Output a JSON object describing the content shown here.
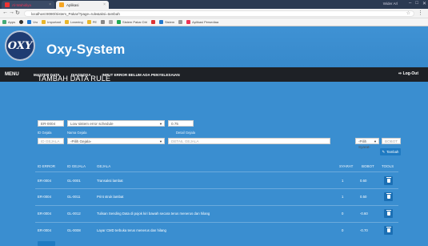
{
  "browser": {
    "tabs": [
      {
        "label": "Al-Wahidiya",
        "active": false
      },
      {
        "label": "Aplikasi",
        "active": true
      }
    ],
    "profile": "Wider Arl",
    "url": "localhost:8080/Sistem_Pakar/?page=rule&aksi=tambah",
    "bookmarks": [
      {
        "label": "Apps"
      },
      {
        "label": ""
      },
      {
        "label": "Vro"
      },
      {
        "label": "Important"
      },
      {
        "label": "Learning"
      },
      {
        "label": "PE"
      },
      {
        "label": ""
      },
      {
        "label": ""
      },
      {
        "label": "Sistem Pakar Diri"
      },
      {
        "label": ""
      },
      {
        "label": "Sistem"
      },
      {
        "label": ""
      },
      {
        "label": "Aplikasi Persediaa"
      }
    ]
  },
  "app": {
    "brand": "Oxy-System",
    "logo_text": "OXY",
    "menu_label": "MENU",
    "nav": [
      "MASTER DATA",
      "DIAGNOSA",
      "INPUT ERROR BELUM ADA PENYELESAIAN"
    ],
    "logout": "Log-Out",
    "page_title": "TAMBAH DATA RULE",
    "form": {
      "id_gejala_value": "ER-0004",
      "nama_gejala_value": "Low sistem error schedule",
      "detail_value": "0.75",
      "label_id": "ID Gejala",
      "label_nama": "Nama Gejala",
      "label_detail": "Detail Gejala",
      "id_gejala_ph": "ID GEJALA",
      "pilih_gejala": "-Pilih Gejala-",
      "detail_gejala_ph": "DETAIL GEJALA",
      "pilih_syarat": "-Pilih Syarat-",
      "bobot_ph": "BOBOT",
      "tambah": "Tambah"
    },
    "table": {
      "headers": [
        "ID ERROR",
        "ID GEJALA",
        "GEJALA",
        "SYARAT",
        "BOBOT",
        "TOOLS"
      ],
      "rows": [
        {
          "id_error": "ER-0004",
          "id_gejala": "GL-0001",
          "gejala": "Transaksi lambat",
          "syarat": "1",
          "bobot": "0.60"
        },
        {
          "id_error": "ER-0004",
          "id_gejala": "GL-0011",
          "gejala": "Print struk lambat",
          "syarat": "1",
          "bobot": "0.50"
        },
        {
          "id_error": "ER-0004",
          "id_gejala": "GL-0012",
          "gejala": "Tulisan Sending Data di pojok kiri bawah secara terus menerus dan hilang",
          "syarat": "0",
          "bobot": "-0.60"
        },
        {
          "id_error": "ER-0004",
          "id_gejala": "GL-0008",
          "gejala": "Layar CMD terbuka terus menerus dan hilang",
          "syarat": "0",
          "bobot": "-0.70"
        }
      ]
    }
  }
}
